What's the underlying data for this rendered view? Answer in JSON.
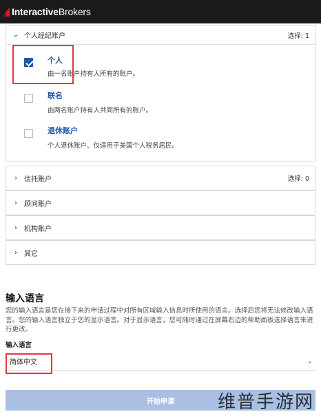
{
  "brand": {
    "text_bold": "Interactive",
    "text_regular": "Brokers",
    "accent_color": "#d71920"
  },
  "personal_group": {
    "title": "个人经纪账户",
    "selection": "选择: 1",
    "options": [
      {
        "title": "个人",
        "desc": "由一名账户持有人所有的账户。",
        "checked": true
      },
      {
        "title": "联名",
        "desc": "由两名账户持有人共同所有的账户。",
        "checked": false
      },
      {
        "title": "退休账户",
        "desc": "个人退休账户、仅适用于美国个人税务居民。",
        "checked": false
      }
    ]
  },
  "collapsed_groups": [
    {
      "title": "信托账户",
      "selection": "选择: 0"
    },
    {
      "title": "顾问账户",
      "selection": ""
    },
    {
      "title": "机构账户",
      "selection": ""
    },
    {
      "title": "其它",
      "selection": ""
    }
  ],
  "language": {
    "title": "输入语言",
    "description": "您的输入语言是您在接下来的申请过程中对所有区域输入信息时所使用的语言。选择后您将无法修改输入语言。您的输入语言独立于您的显示语言。对于显示语言，您可随时通过在屏幕右边的帮助面板选择语言来进行更改。",
    "label": "输入语言",
    "selected": "简体中文"
  },
  "start_button": "开始申请",
  "watermark": "维普手游网",
  "colors": {
    "primary": "#1f58a5",
    "highlight": "#e03a3a",
    "button": "#a9c0e4"
  }
}
